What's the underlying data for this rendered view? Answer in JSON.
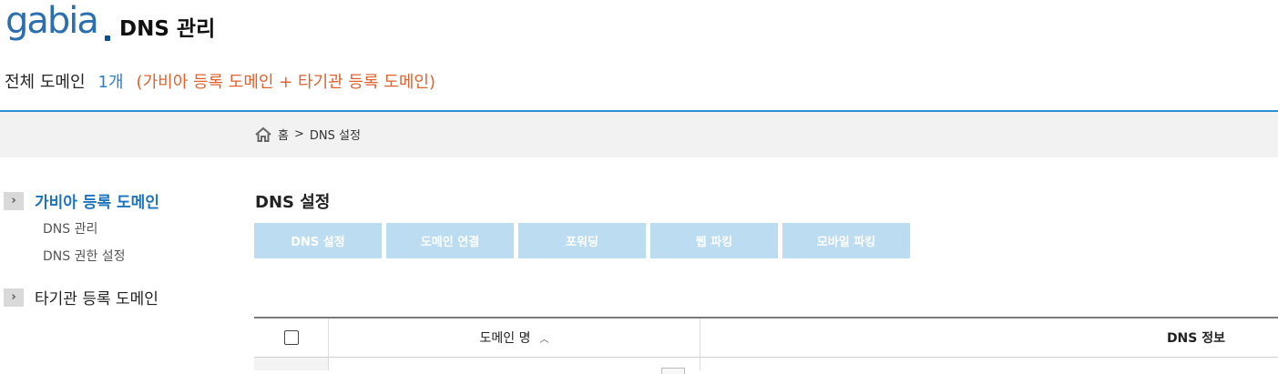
{
  "header": {
    "logo_text": "gabia",
    "title": "DNS 관리"
  },
  "summary": {
    "label": "전체 도메인",
    "count": "1개",
    "note": "(가비아 등록 도메인 + 타기관 등록 도메인)"
  },
  "breadcrumb": {
    "home": "홈",
    "separator": ">",
    "current": "DNS 설정"
  },
  "sidebar": {
    "items": [
      {
        "label": "가비아 등록 도메인",
        "active": true,
        "children": [
          {
            "label": "DNS 관리"
          },
          {
            "label": "DNS 권한 설정"
          }
        ]
      },
      {
        "label": "타기관 등록 도메인",
        "active": false
      }
    ]
  },
  "main": {
    "title": "DNS 설정",
    "tabs": [
      {
        "label": "DNS 설정"
      },
      {
        "label": "도메인 연결"
      },
      {
        "label": "포워딩"
      },
      {
        "label": "웹 파킹"
      },
      {
        "label": "모바일 파킹"
      }
    ],
    "table": {
      "columns": [
        {
          "label": ""
        },
        {
          "label": "도메인 명"
        },
        {
          "label": "DNS 정보"
        }
      ]
    }
  },
  "colors": {
    "accent": "#2d91cf",
    "link_blue": "#1e73be",
    "count_blue": "#2f7ec9",
    "note_orange": "#e0622e",
    "tab_bg": "#bcdcf1"
  },
  "icons": {
    "home": "home-icon",
    "side_arrow": "chevron-right-icon",
    "sort": "sort-up-icon"
  }
}
